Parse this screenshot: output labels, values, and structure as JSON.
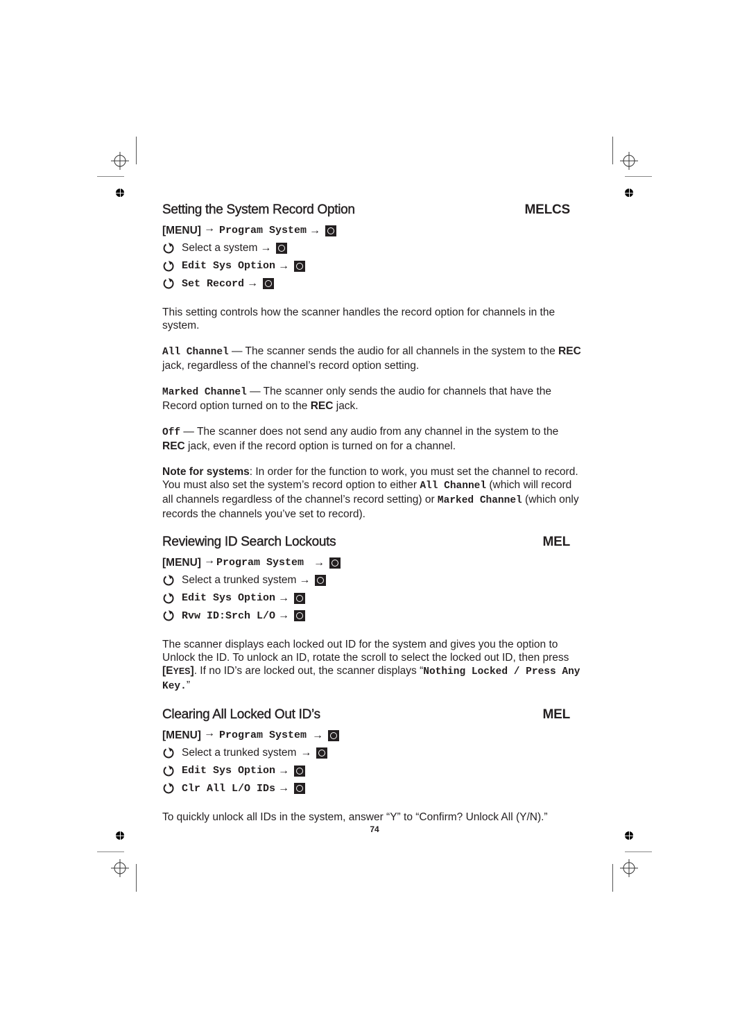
{
  "sections": [
    {
      "title": "Setting the System Record Option",
      "badge": "MELCS",
      "menu_key": "[MENU]",
      "menu_target": "Program System",
      "steps": [
        {
          "text": "Select a system",
          "mono": false
        },
        {
          "text": "Edit Sys Option",
          "mono": true
        },
        {
          "text": "Set Record",
          "mono": true
        }
      ],
      "intro": "This setting controls how the scanner handles the record option for channels in the system.",
      "options": [
        {
          "name": "All Channel",
          "desc_a": " — The scanner sends the audio for all channels in the system to the ",
          "bold": "REC",
          "desc_b": " jack, regardless of the channel’s record option setting."
        },
        {
          "name": "Marked Channel",
          "desc_a": " — The scanner only sends the audio for channels that have the Record option turned on to the ",
          "bold": "REC",
          "desc_b": " jack."
        },
        {
          "name": "Off",
          "desc_a": " — The scanner does not send any audio from any channel in the system to the ",
          "bold": "REC",
          "desc_b": " jack, even if the record option is turned on for a channel."
        }
      ],
      "note": {
        "label": "Note for systems",
        "text_a": ": In order for the function to work, you must set the channel to record. You must also set the system’s record option to either ",
        "mono_a": "All Channel",
        "text_b": " (which will record all channels regardless of the channel’s record setting) or ",
        "mono_b": "Marked Channel",
        "text_c": " (which only records the channels you’ve set to record)."
      }
    },
    {
      "title": "Reviewing ID Search Lockouts",
      "badge": "MEL",
      "menu_key": "[MENU]",
      "menu_target": "Program System",
      "steps": [
        {
          "text": "Select a trunked system",
          "mono": false
        },
        {
          "text": "Edit Sys Option",
          "mono": true
        },
        {
          "text": "Rvw ID:Srch L/O",
          "mono": true
        }
      ],
      "body": {
        "text_a": "The scanner displays each locked out ID for the system and gives you the option to Unlock the ID. To unlock an ID, rotate the scroll to select the locked out ID, then press ",
        "key_open": "[E",
        "key_sc": "YES",
        "key_close": "]",
        "text_b": ". If no ID’s are locked out, the scanner displays “",
        "mono": "Nothing Locked / Press Any Key.",
        "text_c": "”"
      }
    },
    {
      "title": "Clearing All Locked Out ID’s",
      "badge": "MEL",
      "menu_key": "[MENU]",
      "menu_target": "Program System",
      "steps": [
        {
          "text": "Select a trunked system",
          "mono": false
        },
        {
          "text": "Edit Sys Option",
          "mono": true
        },
        {
          "text": "Clr All L/O IDs",
          "mono": true
        }
      ],
      "body": "To quickly unlock all IDs in the system, answer “Y” to “Confirm? Unlock All (Y/N).”"
    }
  ],
  "symbols": {
    "arrow": "→",
    "rotate_icon": "rotate-scroll-icon",
    "knob_icon": "scroll-press-icon"
  },
  "page_number": "74"
}
